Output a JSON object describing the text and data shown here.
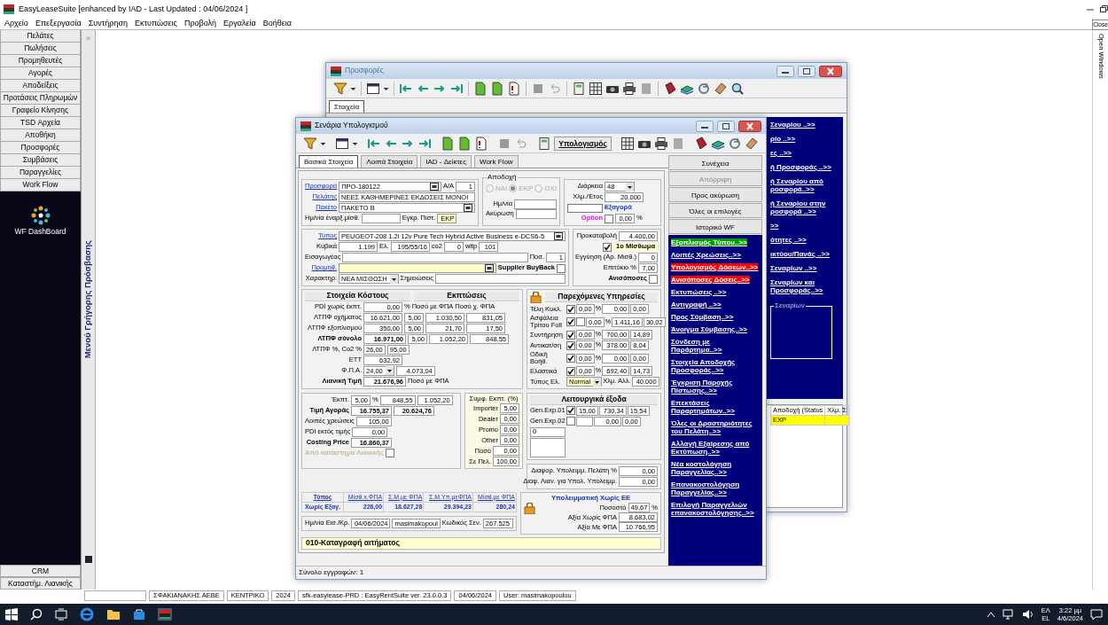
{
  "app": {
    "title": "EasyLeaseSuite [enhanced by IAD - Last Updated : 04/06/2024 ]",
    "menu": [
      "Αρχείο",
      "Επεξεργασία",
      "Συντήρηση",
      "Εκτυπώσεις",
      "Προβολή",
      "Εργαλεία",
      "Βοήθεια"
    ]
  },
  "sidebar": {
    "items": [
      "Πελάτες",
      "Πωλήσεις",
      "Προμηθευτές",
      "Αγορές",
      "Αποδείξεις",
      "Προτάσεις Πληρωμών",
      "Γραφείο Κίνησης",
      "TSD Αρχεία",
      "Αποθήκη",
      "Προσφορές",
      "Συμβάσεις",
      "Παραγγελίες",
      "Work Flow"
    ],
    "dashboard": "WF DashBoard",
    "bottom_items": [
      "CRM",
      "Καταστήμ. Λιανικής"
    ],
    "toggle": "»",
    "quick_menu": "Μενού Γρήγορης Πρόσβασης"
  },
  "right_edge": {
    "close": "Close",
    "open_windows": "Open Windows"
  },
  "offers_window": {
    "title": "Προσφορές",
    "tabs": [
      {
        "label": "Στοιχεία",
        "selected": true
      }
    ],
    "links": [
      "Σεναρίου ..>>",
      "ρίο ..>>",
      "ες ..>>",
      "ή Προσφοράς ..>>",
      "ή Σεναρίου από\nροσφορά..>>",
      "ή Σεναρίου στην\nροσφορά ..>>",
      ">>",
      "ότητες ..>>",
      "ικτύου/Πανάς ..>>",
      "Σεναρίων ..>>",
      "Σεναρίων και\nΠροσφοράς..>>"
    ],
    "group_box": "Σεναρίων",
    "grid": {
      "columns": [
        "Αποδοχή (Status",
        "Χλμ. Σ"
      ],
      "rows": [
        [
          "EXP"
        ]
      ]
    }
  },
  "scenario_window": {
    "title": "Σενάρια Υπολογισμού",
    "toolbar_button": "Υπολογισμός",
    "tabs": [
      {
        "label": "Βασικά Στοιχεία",
        "selected": true
      },
      {
        "label": "Λοιπά Στοιχεία",
        "selected": false
      },
      {
        "label": "IAD - Δείκτες",
        "selected": false
      },
      {
        "label": "Work Flow",
        "selected": false
      }
    ],
    "header_rows": [
      [
        {
          "kind": "link",
          "text": "Προσφορά"
        },
        {
          "kind": "lookup",
          "text": "ΠΡΟ-180122"
        },
        {
          "kind": "label",
          "text": "Α/Α"
        },
        {
          "kind": "small",
          "text": "1"
        }
      ],
      [
        {
          "kind": "link",
          "text": "Πελάτης"
        },
        {
          "kind": "wide",
          "text": "ΝΕΕΣ ΚΑΘΗΜΕΡΙΝΕΣ ΕΚΔΟΣΕΙΣ ΜΟΝΟΙ"
        }
      ],
      [
        {
          "kind": "link",
          "text": "Πακέτο"
        },
        {
          "kind": "lookup",
          "text": "ΠΑΚΕΤΟ Β"
        }
      ],
      [
        {
          "kind": "label",
          "text": "Ημ/νία έναρξ.μίσθ."
        },
        {
          "kind": "field"
        },
        {
          "kind": "label",
          "text": "Εγκρ. Πιστ."
        },
        {
          "kind": "small",
          "text": "ΕΚΡ",
          "highlighted": true
        }
      ]
    ],
    "acceptance": {
      "title": "Αποδοχή",
      "options": [
        {
          "text": "ΝΑΙ",
          "selected": false,
          "disabled": true
        },
        {
          "text": "ΕΚΡ",
          "selected": true,
          "disabled": true
        },
        {
          "text": "ΟΧΙ",
          "selected": false,
          "disabled": true
        }
      ],
      "rows": [
        [
          {
            "kind": "label",
            "text": "Ημ/νία"
          },
          {
            "kind": "wide"
          }
        ],
        [
          {
            "kind": "label",
            "text": "Ακύρωση"
          },
          {
            "kind": "wide"
          }
        ]
      ]
    },
    "terms": [
      [
        {
          "kind": "label",
          "text": "Διάρκεια"
        },
        {
          "kind": "combo",
          "text": "48"
        }
      ],
      [
        {
          "kind": "label",
          "text": "Χλμ./Έτος"
        },
        {
          "kind": "field",
          "text": "20.000"
        }
      ],
      [
        {
          "kind": "check",
          "checked": false,
          "text": "Εξαγορά",
          "color": "#1f3fbf"
        }
      ],
      [
        {
          "kind": "bold",
          "text": "Option",
          "color": "#d01fd0"
        },
        {
          "kind": "check",
          "checked": false
        },
        {
          "kind": "small",
          "text": "0,00"
        },
        {
          "kind": "label",
          "text": "%"
        }
      ]
    ],
    "vehicle": {
      "type_row": [
        {
          "kind": "link",
          "text": "Τύπος"
        },
        {
          "kind": "lookup",
          "text": "PEUGEOT-208 1.2i 12v Pure Tech Hybrid Active Business e-DCS6-5"
        }
      ],
      "specs_row": [
        {
          "kind": "label",
          "text": "Κυβικά"
        },
        {
          "kind": "field",
          "text": "1.199"
        },
        {
          "kind": "label",
          "text": "Ελ."
        },
        {
          "kind": "field",
          "text": "195/55/16"
        },
        {
          "kind": "label",
          "text": "co2"
        },
        {
          "kind": "small",
          "text": "0"
        },
        {
          "kind": "label",
          "text": "wltp"
        },
        {
          "kind": "small",
          "text": "101"
        }
      ],
      "importer_row": [
        {
          "kind": "label",
          "text": "Εισαγωγέας"
        },
        {
          "kind": "wide"
        },
        {
          "kind": "label",
          "text": "Ποσ."
        },
        {
          "kind": "small",
          "text": "1"
        }
      ],
      "supplier_row": [
        {
          "kind": "link",
          "text": "Προμηθ."
        },
        {
          "kind": "lookup",
          "highlighted": true
        },
        {
          "kind": "bold",
          "text": "Supplier BuyBack"
        },
        {
          "kind": "check",
          "checked": false
        }
      ],
      "category_row": [
        {
          "kind": "label",
          "text": "Χαρακτηρ."
        },
        {
          "kind": "combo",
          "text": "ΝΕΑ ΜΙΣΘΩΣΗ"
        },
        {
          "kind": "label",
          "text": "Σημειώσεις"
        },
        {
          "kind": "wide"
        }
      ],
      "side_rows": [
        [
          {
            "kind": "label",
            "text": "Προκαταβολή"
          },
          {
            "kind": "field",
            "text": "4.400,00"
          }
        ],
        [
          {
            "kind": "check",
            "checked": true,
            "text": "1ο Μίσθωμα",
            "highlighted": true
          }
        ],
        [
          {
            "kind": "label",
            "text": "Εγγύηση (Αρ. Μισθ.)"
          },
          {
            "kind": "small",
            "text": "0"
          }
        ],
        [
          {
            "kind": "label",
            "text": "Επιτόκιο %"
          },
          {
            "kind": "small",
            "text": "7,00"
          }
        ],
        [
          {
            "kind": "bold",
            "text": "Ανισόποσες"
          },
          {
            "kind": "check",
            "checked": false
          }
        ]
      ]
    },
    "cost": {
      "headings": [
        "Στοιχεία Κόστους",
        "Εκπτώσεις"
      ],
      "rows": [
        [
          {
            "kind": "label",
            "text": "PDI χωρίς έκπτ."
          },
          {
            "kind": "field",
            "text": "0,00"
          },
          {
            "kind": "label",
            "text": "%"
          },
          {
            "kind": "label",
            "text": "Ποσό με ΦΠΑ"
          },
          {
            "kind": "label",
            "text": "Ποσό χ. ΦΠΑ"
          }
        ],
        [
          {
            "kind": "label",
            "text": "ΛΤΠΦ οχήματος"
          },
          {
            "kind": "field",
            "text": "16.621,00"
          },
          {
            "kind": "small",
            "text": "5,00"
          },
          {
            "kind": "field",
            "text": "1.030,50"
          },
          {
            "kind": "field",
            "text": "831,05"
          }
        ],
        [
          {
            "kind": "label",
            "text": "ΛΤΠΦ εξοπλισμού"
          },
          {
            "kind": "field",
            "text": "350,00"
          },
          {
            "kind": "small",
            "text": "5,00"
          },
          {
            "kind": "field",
            "text": "21,70"
          },
          {
            "kind": "field",
            "text": "17,50"
          }
        ],
        [
          {
            "kind": "bold",
            "text": "ΛΤΠΦ σύνολο"
          },
          {
            "kind": "total",
            "text": "16.971,00"
          },
          {
            "kind": "small",
            "text": "5,00"
          },
          {
            "kind": "field",
            "text": "1.052,20"
          },
          {
            "kind": "field",
            "text": "848,55"
          }
        ],
        [
          {
            "kind": "label",
            "text": "ΛΤΠΦ %, Co2 %"
          },
          {
            "kind": "small",
            "text": "26,00"
          },
          {
            "kind": "small",
            "text": "95,00"
          }
        ],
        [
          {
            "kind": "label",
            "text": "ΕΤΤ"
          },
          {
            "kind": "field",
            "text": "632,92"
          }
        ],
        [
          {
            "kind": "label",
            "text": "Φ.Π.Α."
          },
          {
            "kind": "combo",
            "text": "24,00"
          },
          {
            "kind": "field",
            "text": "4.073,04"
          }
        ],
        [
          {
            "kind": "bold",
            "text": "Λιανική Τιμή"
          },
          {
            "kind": "total",
            "text": "21.676,96"
          },
          {
            "kind": "label",
            "text": "Ποσό με ΦΠΑ"
          }
        ]
      ],
      "lower_rows": [
        [
          {
            "kind": "label",
            "text": "Έκπτ."
          },
          {
            "kind": "small",
            "text": "5,00"
          },
          {
            "kind": "label",
            "text": "%"
          },
          {
            "kind": "field",
            "text": "848,55"
          },
          {
            "kind": "field",
            "text": "1.052,20"
          }
        ],
        [
          {
            "kind": "bold",
            "text": "Τιμή Αγοράς"
          },
          {
            "kind": "total",
            "text": "16.755,37"
          },
          {
            "kind": "total",
            "text": "20.624,76"
          }
        ],
        [
          {
            "kind": "label",
            "text": "Λοιπές χρεώσεις"
          },
          {
            "kind": "field",
            "text": "105,00"
          }
        ],
        [
          {
            "kind": "label",
            "text": "PDI εκτός τιμής"
          },
          {
            "kind": "field",
            "text": "0,00"
          }
        ],
        [
          {
            "kind": "bold",
            "text": "Costing Price"
          },
          {
            "kind": "total",
            "text": "16.860,37"
          }
        ],
        [
          {
            "kind": "dim",
            "text": "Από κατάστημα Λιανικής"
          },
          {
            "kind": "check",
            "checked": false
          }
        ]
      ],
      "agreement": {
        "title": "Συμφ. Εκπτ. (%)",
        "rows": [
          [
            {
              "kind": "label",
              "text": "Importer"
            },
            {
              "kind": "small",
              "text": "5,00"
            }
          ],
          [
            {
              "kind": "label",
              "text": "Dealer"
            },
            {
              "kind": "small",
              "text": "0,00"
            }
          ],
          [
            {
              "kind": "label",
              "text": "Promo"
            },
            {
              "kind": "small",
              "text": "0,00"
            }
          ],
          [
            {
              "kind": "label",
              "text": "Other"
            },
            {
              "kind": "small",
              "text": "0,00"
            }
          ],
          [
            {
              "kind": "label",
              "text": "Ποσό"
            },
            {
              "kind": "field",
              "text": "0,00"
            }
          ],
          [
            {
              "kind": "label",
              "text": "Σε Πελ."
            },
            {
              "kind": "field",
              "text": "100,00"
            }
          ]
        ]
      }
    },
    "services": {
      "title": "Παρεχόμενες Υπηρεσίες",
      "rows": [
        [
          {
            "kind": "label",
            "text": "Τέλη Κυκλ."
          },
          {
            "kind": "check",
            "checked": true
          },
          {
            "kind": "small",
            "text": "0,00"
          },
          {
            "kind": "label",
            "text": "%"
          },
          {
            "kind": "field",
            "text": "0,00"
          },
          {
            "kind": "small",
            "text": "0,00"
          }
        ],
        [
          {
            "kind": "label",
            "text": "Ασφάλεια Τρίτου Full"
          },
          {
            "kind": "check",
            "checked": true
          },
          {
            "kind": "check",
            "checked": false
          },
          {
            "kind": "small",
            "text": "0,00"
          },
          {
            "kind": "label",
            "text": "%"
          },
          {
            "kind": "field",
            "text": "1.411,16"
          },
          {
            "kind": "small",
            "text": "30,02"
          }
        ],
        [
          {
            "kind": "label",
            "text": "Συντήρηση"
          },
          {
            "kind": "check",
            "checked": true
          },
          {
            "kind": "small",
            "text": "0,00"
          },
          {
            "kind": "label",
            "text": "%"
          },
          {
            "kind": "field",
            "text": "700,00"
          },
          {
            "kind": "small",
            "text": "14,89"
          }
        ],
        [
          {
            "kind": "label",
            "text": "Αντικατ/ση"
          },
          {
            "kind": "check",
            "checked": true
          },
          {
            "kind": "small",
            "text": "0,00"
          },
          {
            "kind": "label",
            "text": "%"
          },
          {
            "kind": "field",
            "text": "378,00"
          },
          {
            "kind": "small",
            "text": "8,04"
          }
        ],
        [
          {
            "kind": "label",
            "text": "Οδική Βοήθ."
          },
          {
            "kind": "check",
            "checked": true
          },
          {
            "kind": "small",
            "text": "0,00"
          },
          {
            "kind": "label",
            "text": "%"
          },
          {
            "kind": "field",
            "text": "0,00"
          },
          {
            "kind": "small",
            "text": "0,00"
          }
        ],
        [
          {
            "kind": "label",
            "text": "Ελαστικά"
          },
          {
            "kind": "check",
            "checked": true
          },
          {
            "kind": "small",
            "text": "0,00"
          },
          {
            "kind": "label",
            "text": "%"
          },
          {
            "kind": "field",
            "text": "692,40"
          },
          {
            "kind": "small",
            "text": "14,73"
          }
        ]
      ],
      "tyre_row": [
        {
          "kind": "label",
          "text": "Τύπος Ελ."
        },
        {
          "kind": "combo",
          "text": "Normal",
          "highlighted": true
        },
        {
          "kind": "label",
          "text": "Χλμ. Αλλ."
        },
        {
          "kind": "field",
          "text": "40.000"
        }
      ]
    },
    "expenses": {
      "title": "Λειτουργικά έξοδα",
      "rows": [
        [
          {
            "kind": "label",
            "text": "Gen.Exp.01"
          },
          {
            "kind": "check",
            "checked": true
          },
          {
            "kind": "small",
            "text": "15,00"
          },
          {
            "kind": "field",
            "text": "730,34"
          },
          {
            "kind": "small",
            "text": "15,54"
          }
        ],
        [
          {
            "kind": "label",
            "text": "Gen.Exp.02"
          },
          {
            "kind": "check",
            "checked": false
          },
          {
            "kind": "small"
          },
          {
            "kind": "field",
            "text": "0,00"
          },
          {
            "kind": "small",
            "text": "0,00"
          }
        ],
        [
          {
            "kind": "wide",
            "text": "0"
          }
        ],
        [
          {
            "kind": "memo"
          }
        ]
      ]
    },
    "residual_diff": [
      [
        {
          "kind": "label",
          "text": "Διαφορ. Υπολειμμ. Πελάτη %"
        },
        {
          "kind": "field",
          "text": "0,00"
        }
      ],
      [
        {
          "kind": "label",
          "text": "Διαφ. Λιαν. για Υπολ. Υπολειμμ."
        },
        {
          "kind": "field",
          "text": "0,00"
        }
      ]
    ],
    "summary": {
      "columns": [
        "Τύπος",
        "Μίσθ.x.ΦΠΑ",
        "Σ.Μ.με ΦΠΑ",
        "Σ.Μ.Υπ.μεΦΠΑ",
        "Μίσθ.με ΦΠΑ"
      ],
      "rows": [
        [
          "Χωρίς Εξαγ.",
          "226,00",
          "18.627,28",
          "29.394,23",
          "280,24"
        ]
      ]
    },
    "date_row": [
      {
        "kind": "label",
        "text": "Ημ/νία Εισ./Κρ."
      },
      {
        "kind": "field",
        "text": "04/06/2024"
      },
      {
        "kind": "field",
        "text": "masimakopoul"
      },
      {
        "kind": "label",
        "text": "Κωδικός Σεν."
      },
      {
        "kind": "wide",
        "text": "267.525"
      }
    ],
    "residual": {
      "title": "Υπολειμματική Χωρίς ΕΕ",
      "rows": [
        [
          {
            "kind": "label",
            "text": "Ποσοστό"
          },
          {
            "kind": "small",
            "text": "49,67"
          },
          {
            "kind": "label",
            "text": "%"
          }
        ],
        [
          {
            "kind": "label",
            "text": "Αξία Χωρίς ΦΠΑ"
          },
          {
            "kind": "field",
            "text": "8.683,02"
          }
        ],
        [
          {
            "kind": "label",
            "text": "Αξία Με ΦΠΑ"
          },
          {
            "kind": "field",
            "text": "10.766,95"
          }
        ]
      ]
    },
    "workflow_status": "010-Καταγραφή αιτήματος",
    "record_count": "Σύνολο εγγραφών: 1",
    "actions": [
      {
        "label": "Συνέχεια",
        "disabled": false
      },
      {
        "label": "Απόρριψη",
        "disabled": true
      },
      {
        "label": "Προς ακύρωση",
        "disabled": false
      },
      {
        "label": "Όλες οι επιλογές",
        "disabled": false
      },
      {
        "label": "Ιστορικό WF",
        "disabled": false
      }
    ],
    "links": [
      {
        "text": "Εξοπλισμός Τύπου..>>",
        "color": "#00a000"
      },
      {
        "text": "Λοιπές Χρεώσεις..>>"
      },
      {
        "text": "Υπολογισμός Δόσεων..>>",
        "color": "#ff0000"
      },
      {
        "text": "Ανισόποσες Δόσεις..>>",
        "color": "#ff0000"
      },
      {
        "text": "Εκτυπώσεις ..>>"
      },
      {
        "text": "Αντιγραφή ..>>"
      },
      {
        "text": "Προς Σύμβαση..>>"
      },
      {
        "text": "Άνοιγμα Σύμβασης..>>"
      },
      {
        "text": "Σύνδεση με Παράρτημα..>>"
      },
      {
        "text": "Στοιχεία Αποδοχής Προσφοράς..>>"
      },
      {
        "text": "Έγκριση Παροχής Πίστωσης..>>"
      },
      {
        "text": "Επεκτάσεις Παραρτημάτων..>>"
      },
      {
        "text": "Όλες οι Δραστηριότητες του Πελάτη..>>"
      },
      {
        "text": "Αλλαγή Εξαίρεσης από Εκτύπωση..>>"
      },
      {
        "text": "Νέα κοστολόγηση Παραγγελίας..>>"
      },
      {
        "text": "Επανακοστολόγηση Παραγγελίας..>>"
      },
      {
        "text": "Επιλογή Παραγγελιών επανακοστολόγησης..>>"
      }
    ]
  },
  "status_bar": [
    "ΣΦΑΚΙΑΝΑΚΗΣ ΑΕΒΕ",
    "ΚΕΝΤΡΙΚΟ",
    "2024",
    "sfk-easylease-PRD : EasyRentSuite  ver. 23.0.0.3",
    "04/06/2024",
    "User: masimakopoulou"
  ],
  "taskbar": {
    "language": "ΕΛ",
    "layout": "EL",
    "time": "3:22 μμ",
    "date": "4/6/2024"
  }
}
